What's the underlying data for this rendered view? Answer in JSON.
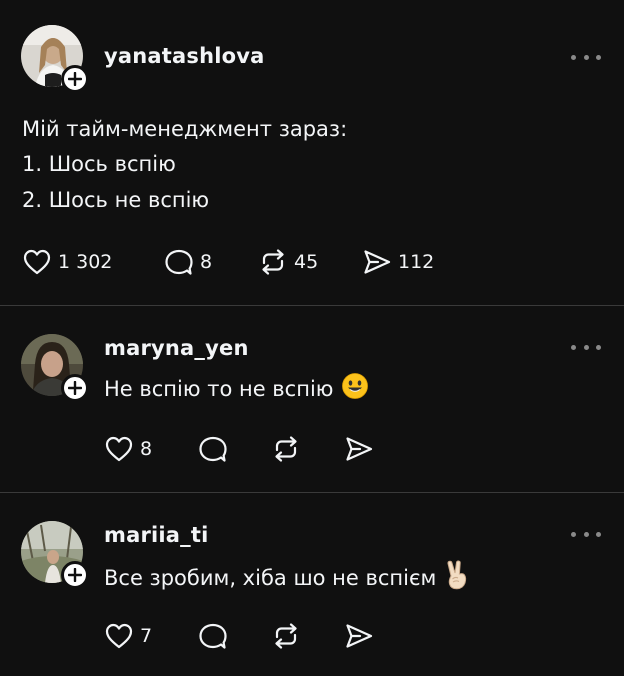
{
  "post": {
    "username": "yanatashlova",
    "lines": [
      "Мій тайм-менеджмент зараз:",
      "1. Шось вспію",
      "2. Шось не вспію"
    ],
    "likes": "1 302",
    "comments": "8",
    "reposts": "45",
    "shares": "112"
  },
  "replies": [
    {
      "username": "maryna_yen",
      "text": "Не вспію то не вспію",
      "emoji": "smiling-face",
      "likes": "8"
    },
    {
      "username": "mariia_ti",
      "text": "Все зробим, хіба шо не вспієм",
      "emoji": "victory-hand",
      "likes": "7"
    }
  ]
}
